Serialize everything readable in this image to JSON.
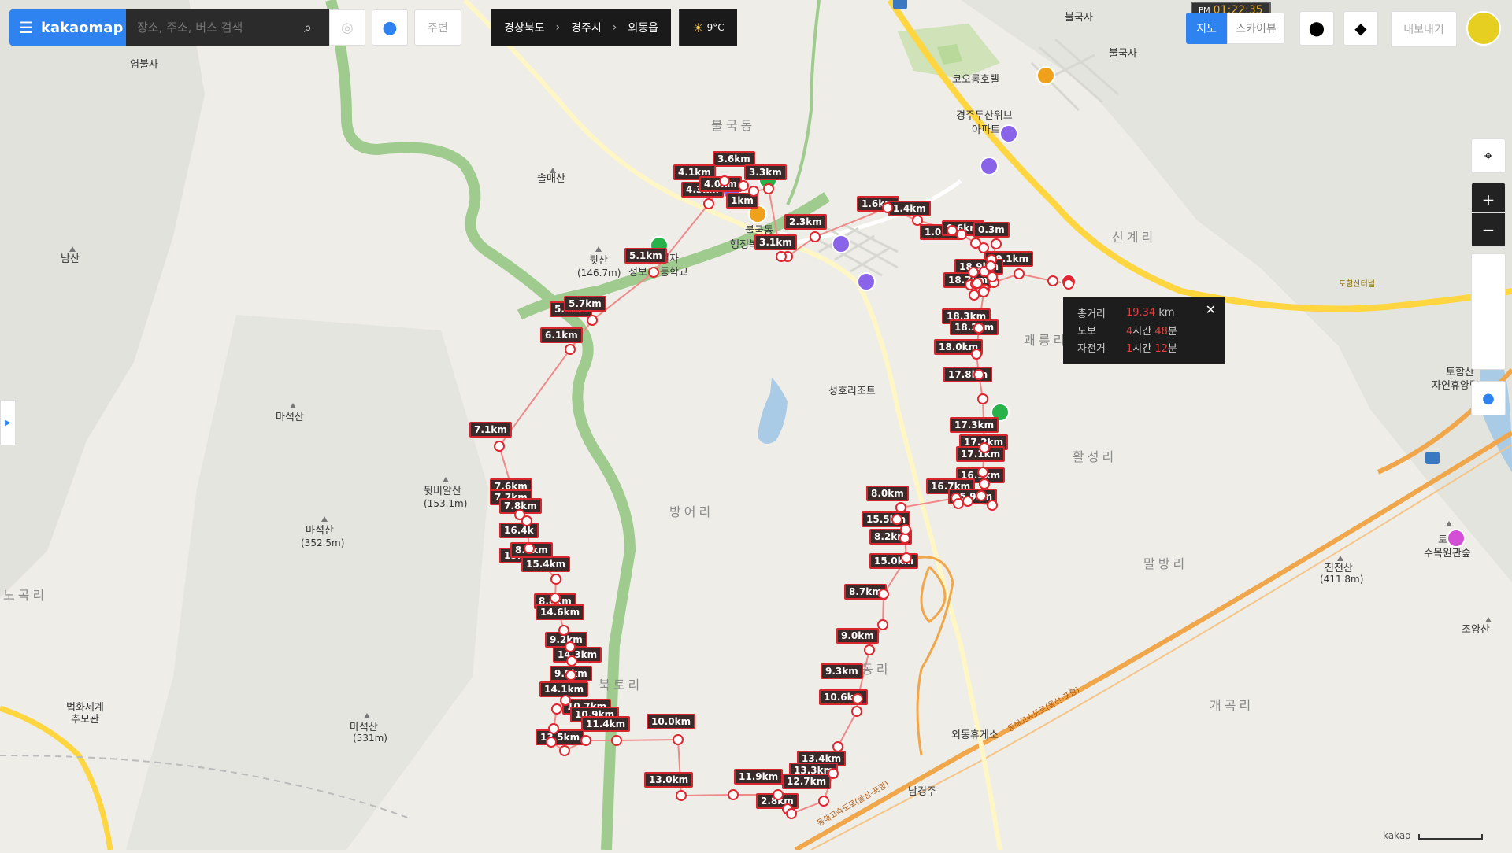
{
  "app": {
    "logo": "kakaomap",
    "menu_icon": "hamburger-icon"
  },
  "search": {
    "placeholder": "장소, 주소, 버스 검색",
    "icon": "search-icon"
  },
  "nearby_label": "주변",
  "breadcrumb": {
    "province": "경상북도",
    "city": "경주시",
    "district": "외동읍"
  },
  "weather": {
    "icon": "sun-cloud-icon",
    "temp": "9°C"
  },
  "clock": {
    "ampm": "PM",
    "time": "01:22:35"
  },
  "map_type": {
    "map": "지도",
    "skyview": "스카이뷰"
  },
  "export_label": "내보내기",
  "distance_info": {
    "total_label": "총거리",
    "total_value": "19.34",
    "total_unit": "km",
    "walk_label": "도보",
    "walk_h": "4",
    "walk_h_unit": "시간",
    "walk_m": "48",
    "walk_m_unit": "분",
    "bike_label": "자전거",
    "bike_h": "1",
    "bike_h_unit": "시간",
    "bike_m": "12",
    "bike_m_unit": "분"
  },
  "scale_label": "kakao",
  "place_labels": [
    {
      "text": "염불사"
    },
    {
      "text": "불국사"
    },
    {
      "text": "불국사"
    },
    {
      "text": "코오롱호텔"
    },
    {
      "text": "경주두산위브"
    },
    {
      "text": "아파트"
    },
    {
      "text": "불국동"
    },
    {
      "text": "솔매산"
    },
    {
      "text": "남산"
    },
    {
      "text": "뒷산"
    },
    {
      "text": "(146.7m)"
    },
    {
      "text": "불국동"
    },
    {
      "text": "행정복"
    },
    {
      "text": "여자"
    },
    {
      "text": "정보"
    },
    {
      "text": "등학교"
    },
    {
      "text": "신계리"
    },
    {
      "text": "괘릉리"
    },
    {
      "text": "토함산"
    },
    {
      "text": "자연휴양림"
    },
    {
      "text": "마석산"
    },
    {
      "text": "성호리조트"
    },
    {
      "text": "활성리"
    },
    {
      "text": "뒷비알산"
    },
    {
      "text": "(153.1m)"
    },
    {
      "text": "마석산"
    },
    {
      "text": "(352.5m)"
    },
    {
      "text": "방어리"
    },
    {
      "text": "노곡리"
    },
    {
      "text": "말방리"
    },
    {
      "text": "토"
    },
    {
      "text": "수목원관숲"
    },
    {
      "text": "진전산"
    },
    {
      "text": "(411.8m)"
    },
    {
      "text": "조양산"
    },
    {
      "text": "북토리"
    },
    {
      "text": "법화세계"
    },
    {
      "text": "추모관"
    },
    {
      "text": "마석산"
    },
    {
      "text": "(531m)"
    },
    {
      "text": "외동휴게소"
    },
    {
      "text": "개곡리"
    },
    {
      "text": "남경주"
    },
    {
      "text": "동리"
    },
    {
      "text": "동해고속도로(울산-포항)"
    },
    {
      "text": "동해고속도로(울산-포항)"
    },
    {
      "text": "토함산터널"
    },
    {
      "text": "4"
    },
    {
      "text": "65"
    }
  ],
  "route_labels": [
    "3.6km",
    "4.1km",
    "3.3km",
    "4.3km",
    "4.0km",
    "2.3km",
    "1.6km",
    "1.4km",
    "1.0km",
    "0.6km",
    "0.3m",
    "19.1km",
    "18.9km",
    "18.7km",
    "5.1km",
    "5.8km",
    "5.7km",
    "6.1km",
    "18.3km",
    "18.2km",
    "18.0km",
    "17.8km",
    "7.1km",
    "17.3km",
    "17.2km",
    "17.1km",
    "16.9km",
    "7.6km",
    "7.7km",
    "7.8km",
    "16.4k",
    "16.7km",
    "15.9km",
    "8.0km",
    "15.7km",
    "15.5km",
    "8.2km",
    "8.3km",
    "15.4km",
    "15.0km",
    "8.7km",
    "8.8km",
    "14.6km",
    "9.0km",
    "9.2km",
    "14.3km",
    "9.3km",
    "9.5km",
    "14.1km",
    "10.6km",
    "10.7km",
    "10.9km",
    "11.4km",
    "10.0km",
    "13.5km",
    "13.4km",
    "13.3km",
    "12.7km",
    "11.9km",
    "13.0km",
    "2.8km",
    "3.1km",
    "1km"
  ]
}
